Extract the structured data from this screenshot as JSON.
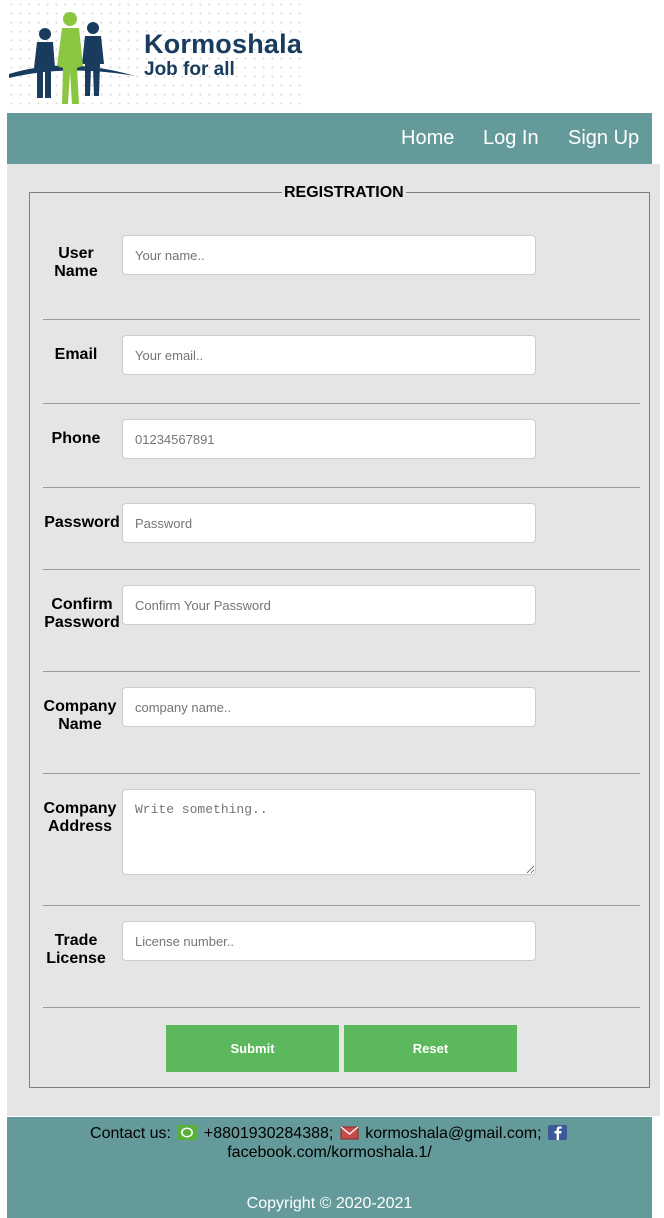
{
  "brand": {
    "name": "Kormoshala",
    "tagline": "Job for all",
    "colors": {
      "navy": "#183b5e",
      "green": "#8ac63f",
      "teal": "#659a9a",
      "button_green": "#5cb85c"
    }
  },
  "nav": {
    "home": "Home",
    "login": "Log In",
    "signup": "Sign Up"
  },
  "form": {
    "legend": "REGISTRATION",
    "fields": {
      "user_name": {
        "label": "User Name",
        "value": "",
        "placeholder": "Your name.."
      },
      "email": {
        "label": "Email",
        "value": "",
        "placeholder": "Your email.."
      },
      "phone": {
        "label": "Phone",
        "value": "",
        "placeholder": "01234567891"
      },
      "password": {
        "label": "Password",
        "value": "",
        "placeholder": "Password"
      },
      "confirm_password": {
        "label": "Confirm Password",
        "value": "",
        "placeholder": "Confirm Your Password"
      },
      "company_name": {
        "label": "Company Name",
        "value": "",
        "placeholder": "company name.."
      },
      "company_address": {
        "label": "Company Address",
        "value": "",
        "placeholder": "Write something.."
      },
      "trade_license": {
        "label": "Trade License",
        "value": "",
        "placeholder": "License number.."
      }
    },
    "submit_label": "Submit",
    "reset_label": "Reset"
  },
  "footer": {
    "contact_prefix": "Contact us:",
    "phone": "+8801930284388;",
    "email": "kormoshala@gmail.com;",
    "facebook": "facebook.com/kormoshala.1/",
    "copyright": "Copyright © 2020-2021",
    "icons": [
      "whatsapp-icon",
      "mail-icon",
      "facebook-icon"
    ]
  }
}
